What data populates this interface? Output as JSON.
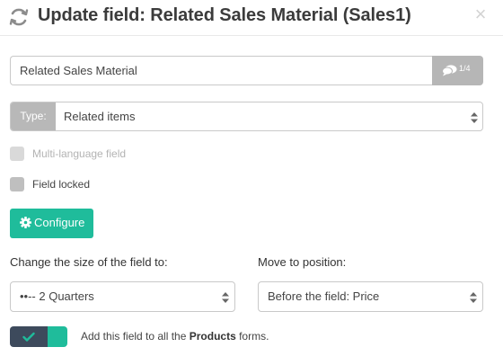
{
  "header": {
    "title": "Update field: Related Sales Material (Sales1)",
    "close_symbol": "×"
  },
  "name_field": {
    "value": "Related Sales Material",
    "languages_count": "1/4"
  },
  "type_select": {
    "label": "Type:",
    "value": "Related items"
  },
  "options": {
    "multi_language": {
      "label": "Multi-language field",
      "checked": false,
      "disabled": true
    },
    "field_locked": {
      "label": "Field locked",
      "checked": false,
      "disabled": false
    }
  },
  "configure": {
    "label": "Configure"
  },
  "size": {
    "label": "Change the size of the field to:",
    "value": "••-- 2 Quarters"
  },
  "position": {
    "label": "Move to position:",
    "value": "Before the field: Price"
  },
  "add_to_all": {
    "prefix": "Add this field to all the ",
    "entity": "Products",
    "suffix": " forms.",
    "enabled": true
  },
  "colors": {
    "accent": "#1fbc9b",
    "toggle_dark": "#3d4a5c",
    "grey_button": "#b6b6b6"
  },
  "icons": {
    "refresh": "refresh-icon",
    "close": "close-icon",
    "languages": "chat-bubbles-icon",
    "select": "updown-arrows-icon",
    "configure": "gear-icon",
    "toggle": "check-icon"
  }
}
